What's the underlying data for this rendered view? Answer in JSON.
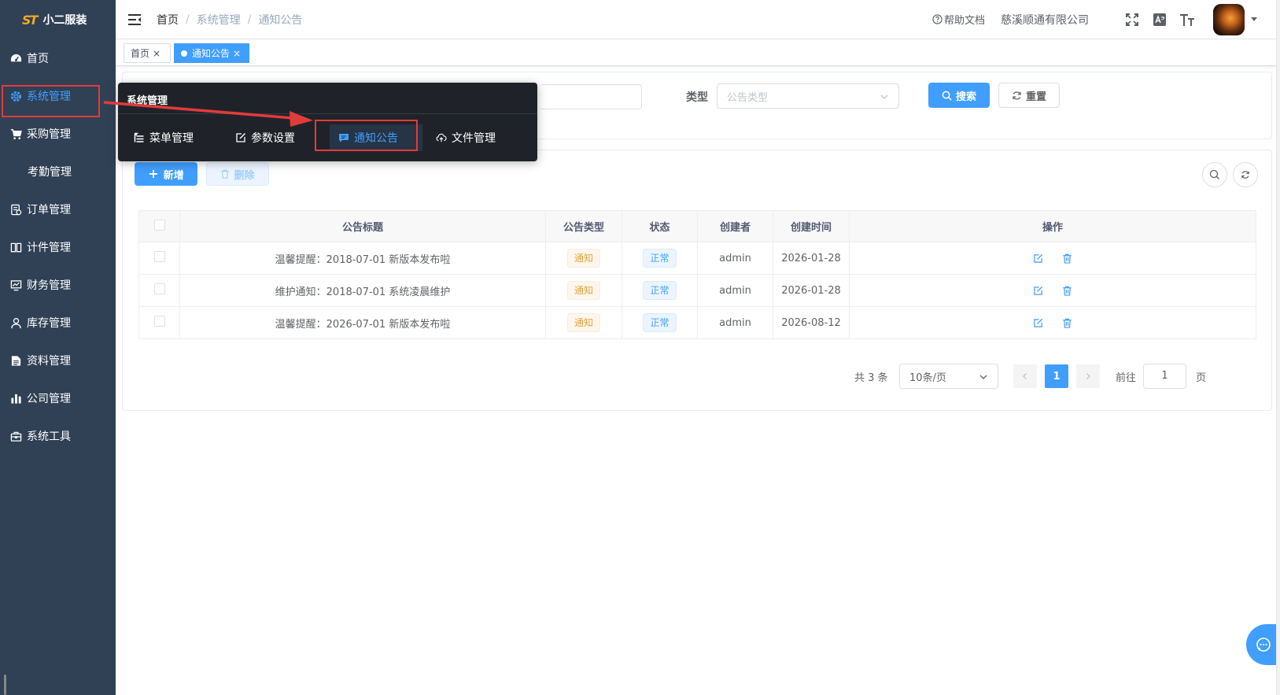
{
  "brand": {
    "logo_text": "小二服装",
    "logo_mark": "ST"
  },
  "sidebar": {
    "items": [
      {
        "label": "首页",
        "icon": "dashboard-icon"
      },
      {
        "label": "系统管理",
        "icon": "gear-icon",
        "active": true
      },
      {
        "label": "采购管理",
        "icon": "cart-icon"
      },
      {
        "label": "考勤管理",
        "icon": ""
      },
      {
        "label": "订单管理",
        "icon": "order-icon"
      },
      {
        "label": "计件管理",
        "icon": "book-icon"
      },
      {
        "label": "财务管理",
        "icon": "finance-icon"
      },
      {
        "label": "库存管理",
        "icon": "user-icon"
      },
      {
        "label": "资料管理",
        "icon": "document-icon"
      },
      {
        "label": "公司管理",
        "icon": "chart-icon"
      },
      {
        "label": "系统工具",
        "icon": "toolbox-icon"
      }
    ]
  },
  "header": {
    "breadcrumb": [
      "首页",
      "系统管理",
      "通知公告"
    ],
    "help_label": "帮助文档",
    "company": "慈溪顺通有限公司"
  },
  "tags": [
    {
      "label": "首页"
    },
    {
      "label": "通知公告",
      "active": true
    }
  ],
  "search": {
    "type_label": "类型",
    "type_placeholder": "公告类型",
    "search_btn": "搜索",
    "reset_btn": "重置"
  },
  "toolbar": {
    "add_btn": "新增",
    "delete_btn": "删除"
  },
  "table": {
    "columns": [
      "公告标题",
      "公告类型",
      "状态",
      "创建者",
      "创建时间",
      "操作"
    ],
    "rows": [
      {
        "title": "温馨提醒：2018-07-01 新版本发布啦",
        "type": "通知",
        "status": "正常",
        "creator": "admin",
        "created": "2026-01-28"
      },
      {
        "title": "维护通知：2018-07-01 系统凌晨维护",
        "type": "通知",
        "status": "正常",
        "creator": "admin",
        "created": "2026-01-28"
      },
      {
        "title": "温馨提醒：2026-07-01 新版本发布啦",
        "type": "通知",
        "status": "正常",
        "creator": "admin",
        "created": "2026-08-12"
      }
    ]
  },
  "pagination": {
    "total": "共 3 条",
    "page_size": "10条/页",
    "current": "1",
    "goto_label": "前往",
    "goto_value": "1",
    "page_unit": "页"
  },
  "popup": {
    "title": "系统管理",
    "items": [
      {
        "label": "菜单管理",
        "icon": "tree-table-icon"
      },
      {
        "label": "参数设置",
        "icon": "edit-icon"
      },
      {
        "label": "通知公告",
        "icon": "message-icon",
        "active": true
      },
      {
        "label": "文件管理",
        "icon": "upload-cloud-icon"
      }
    ]
  },
  "colors": {
    "sidebar_bg": "#304156",
    "primary": "#409eff",
    "popup_bg": "#1f2329",
    "highlight": "#e23b3b"
  }
}
